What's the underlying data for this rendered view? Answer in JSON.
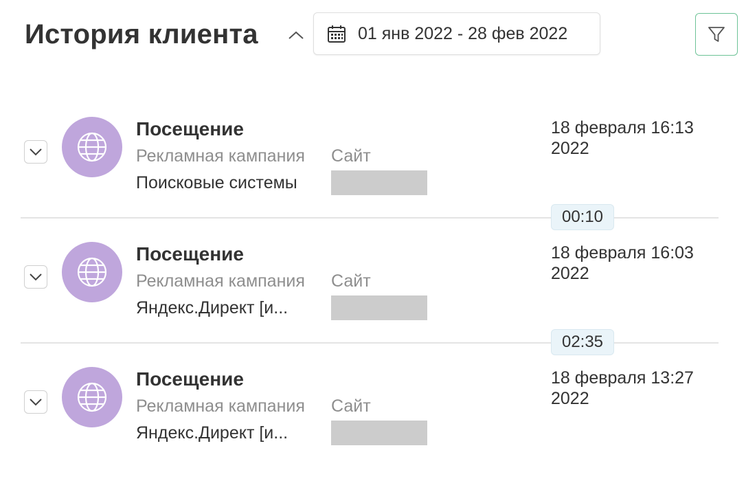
{
  "header": {
    "title": "История клиента",
    "date_range": "01 янв 2022 - 28 фев 2022"
  },
  "icons": {
    "collapse": "chevron-up-icon",
    "calendar": "calendar-icon",
    "filter": "filter-icon",
    "expand": "chevron-down-icon",
    "event": "globe-icon"
  },
  "colors": {
    "avatar_bg": "#bfa6dc",
    "filter_border": "#6cc296",
    "duration_bg": "#eaf4f9"
  },
  "events": [
    {
      "title": "Посещение",
      "campaign_label": "Рекламная кампания",
      "site_label": "Сайт",
      "campaign_value": "Поисковые системы",
      "time": "18 февраля 16:13",
      "year": "2022"
    },
    {
      "title": "Посещение",
      "campaign_label": "Рекламная кампания",
      "site_label": "Сайт",
      "campaign_value": "Яндекс.Директ [и...",
      "time": "18 февраля 16:03",
      "year": "2022"
    },
    {
      "title": "Посещение",
      "campaign_label": "Рекламная кампания",
      "site_label": "Сайт",
      "campaign_value": "Яндекс.Директ [и...",
      "time": "18 февраля 13:27",
      "year": "2022"
    }
  ],
  "durations": [
    "00:10",
    "02:35"
  ]
}
